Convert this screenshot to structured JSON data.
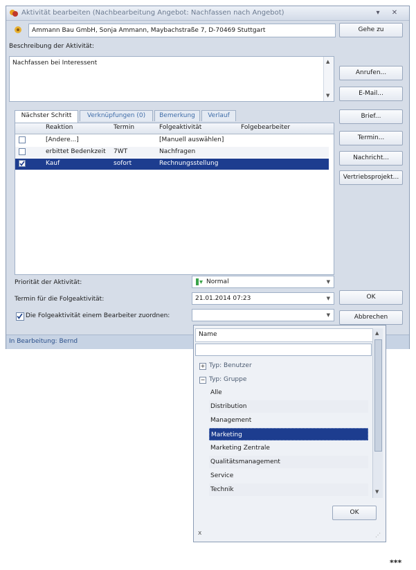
{
  "window": {
    "title": "Aktivität bearbeiten (Nachbearbeitung Angebot: Nachfassen nach Angebot)",
    "pin_glyph": "▾",
    "close_glyph": "✕"
  },
  "contact": {
    "value": "Ammann Bau GmbH, Sonja Ammann, Maybachstraße 7, D-70469 Stuttgart",
    "goto_label": "Gehe zu"
  },
  "description": {
    "label": "Beschreibung der Aktivität:",
    "value": "Nachfassen bei Interessent"
  },
  "actions": {
    "call": "Anrufen...",
    "email": "E-Mail...",
    "letter": "Brief...",
    "appointment": "Termin...",
    "message": "Nachricht...",
    "sales_project": "Vertriebsprojekt...",
    "ok": "OK",
    "cancel": "Abbrechen"
  },
  "tabs": [
    {
      "label": "Nächster Schritt",
      "active": true
    },
    {
      "label": "Verknüpfungen (0)",
      "active": false
    },
    {
      "label": "Bemerkung",
      "active": false
    },
    {
      "label": "Verlauf",
      "active": false
    }
  ],
  "grid": {
    "columns": [
      "Reaktion",
      "Termin",
      "Folgeaktivität",
      "Folgebearbeiter"
    ],
    "rows": [
      {
        "reaktion": "[Andere...]",
        "termin": "",
        "folge": "[Manuell auswählen]",
        "bearbeiter": "",
        "checked": false,
        "selected": false
      },
      {
        "reaktion": "erbittet Bedenkzeit",
        "termin": "7WT",
        "folge": "Nachfragen",
        "bearbeiter": "",
        "checked": false,
        "selected": false
      },
      {
        "reaktion": "Kauf",
        "termin": "sofort",
        "folge": "Rechnungsstellung",
        "bearbeiter": "",
        "checked": true,
        "selected": true
      }
    ]
  },
  "form": {
    "priority_label": "Priorität der Aktivität:",
    "priority_value": "Normal",
    "date_label": "Termin für die Folgeaktivität:",
    "date_value": "21.01.2014 07:23",
    "assign_label": "Die Folgeaktivität einem Bearbeiter zuordnen:",
    "assign_checked": true,
    "assign_value": ""
  },
  "status": {
    "text": "In Bearbeitung: Bernd"
  },
  "popup": {
    "header": "Name",
    "search_value": "",
    "groups": [
      {
        "label": "Typ: Benutzer",
        "expanded": false
      },
      {
        "label": "Typ: Gruppe",
        "expanded": true
      }
    ],
    "items": [
      "Alle",
      "Distribution",
      "Management",
      "Marketing",
      "Marketing Zentrale",
      "Qualitätsmanagement",
      "Service",
      "Technik"
    ],
    "selected_item": "Marketing",
    "ok_label": "OK",
    "close_glyph": "x"
  },
  "page": {
    "footer_mark": "***"
  },
  "colors": {
    "selection": "#1d3d8f",
    "window_bg": "#d6dde8",
    "priority_icon": "#3aa34a"
  }
}
